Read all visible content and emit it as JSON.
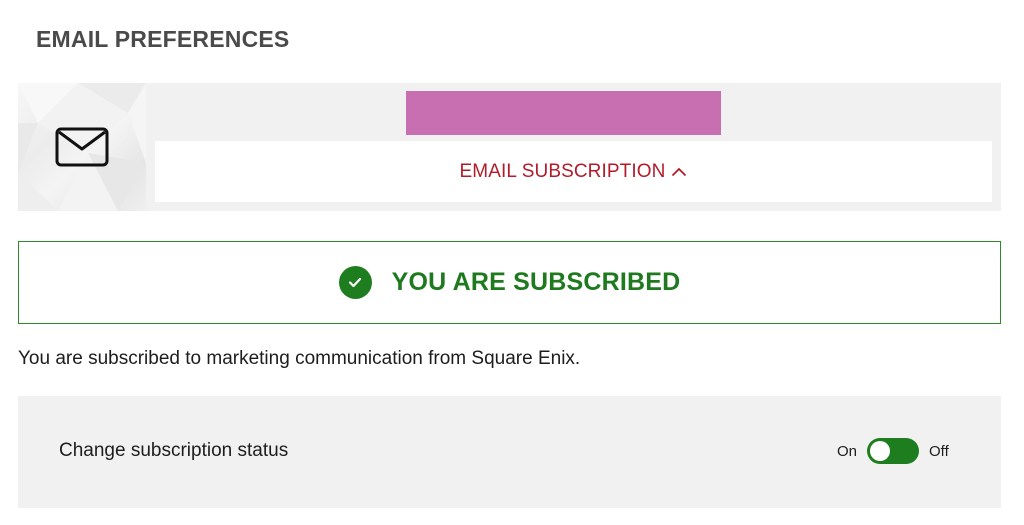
{
  "header": {
    "title": "EMAIL PREFERENCES"
  },
  "subscription_panel": {
    "icon": "envelope-icon",
    "email_redacted_color": "#c76fb0",
    "toggle_label": "EMAIL SUBSCRIPTION",
    "toggle_icon": "chevron-up-icon",
    "accent_color": "#b31b2b"
  },
  "status_banner": {
    "icon": "check-circle-icon",
    "text": "YOU ARE SUBSCRIBED",
    "color": "#1f7a1f"
  },
  "description": "You are subscribed to marketing communication from Square Enix.",
  "change_status": {
    "label": "Change subscription status",
    "on_label": "On",
    "off_label": "Off",
    "switch_color": "#1e7d1e"
  }
}
